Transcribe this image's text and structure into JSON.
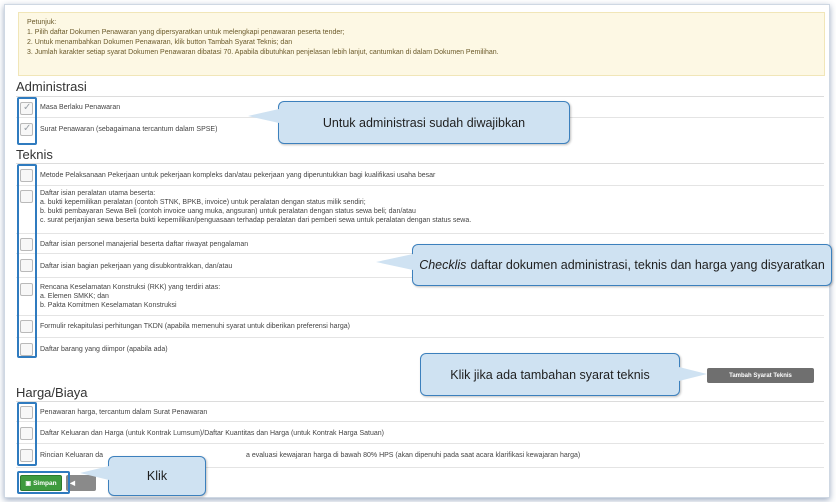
{
  "petunjuk": {
    "title": "Petunjuk:",
    "lines": [
      "1. Pilih daftar Dokumen Penawaran yang dipersyaratkan untuk melengkapi penawaran peserta tender;",
      "2. Untuk menambahkan Dokumen Penawaran, klik button Tambah Syarat Teknis; dan",
      "3. Jumlah karakter setiap syarat Dokumen Penawaran dibatasi 70. Apabila dibutuhkan penjelasan lebih lanjut, cantumkan di dalam Dokumen Pemilihan."
    ]
  },
  "administrasi": {
    "title": "Administrasi",
    "items": [
      {
        "label": "Masa Berlaku Penawaran",
        "checked": true
      },
      {
        "label": "Surat Penawaran (sebagaimana tercantum dalam SPSE)",
        "checked": true
      }
    ]
  },
  "teknis": {
    "title": "Teknis",
    "items": [
      {
        "lines": [
          "Metode Pelaksanaan Pekerjaan untuk pekerjaan kompleks dan/atau pekerjaan yang diperuntukkan bagi kualifikasi usaha besar"
        ],
        "checked": false
      },
      {
        "lines": [
          "Daftar isian peralatan utama beserta:",
          "a. bukti kepemilikan peralatan (contoh STNK, BPKB, invoice) untuk peralatan dengan status milik sendiri;",
          "b. bukti pembayaran Sewa Beli (contoh invoice uang muka, angsuran) untuk peralatan dengan status sewa beli; dan/atau",
          "c. surat perjanjian sewa beserta bukti kepemilikan/penguasaan terhadap peralatan dari pemberi sewa untuk peralatan dengan status sewa."
        ],
        "checked": false
      },
      {
        "lines": [
          "Daftar isian personel manajerial beserta daftar riwayat pengalaman"
        ],
        "checked": false
      },
      {
        "lines": [
          "Daftar isian bagian pekerjaan yang disubkontrakkan, dan/atau"
        ],
        "checked": false
      },
      {
        "lines": [
          "Rencana Keselamatan Konstruksi (RKK) yang terdiri atas:",
          "a. Elemen SMKK; dan",
          "b. Pakta Komitmen Keselamatan Konstruksi"
        ],
        "checked": false
      },
      {
        "lines": [
          "Formulir rekapitulasi perhitungan TKDN (apabila memenuhi syarat untuk diberikan preferensi harga)"
        ],
        "checked": false
      },
      {
        "lines": [
          "Daftar barang yang diimpor (apabila ada)"
        ],
        "checked": false
      }
    ],
    "add_button": "Tambah Syarat Teknis"
  },
  "harga": {
    "title": "Harga/Biaya",
    "items": [
      {
        "label": "Penawaran harga, tercantum dalam Surat Penawaran",
        "checked": false
      },
      {
        "label": "Daftar Keluaran dan Harga (untuk Kontrak Lumsum)/Daftar Kuantitas dan Harga (untuk Kontrak Harga Satuan)",
        "checked": false
      },
      {
        "label_left": "Rincian Keluaran da",
        "label_right": "a evaluasi kewajaran harga di bawah 80% HPS (akan dipenuhi pada saat acara klarifikasi kewajaran harga)",
        "checked": false
      }
    ]
  },
  "buttons": {
    "save": "Simpan",
    "back_icon": "◀"
  },
  "callouts": {
    "admin": "Untuk administrasi sudah diwajibkan",
    "checklist_italic": "Checklis",
    "checklist_rest": "daftar dokumen administrasi, teknis dan harga yang disyaratkan",
    "tambah": "Klik jika ada tambahan syarat teknis",
    "klik": "Klik"
  },
  "icons": {
    "save": "floppy-icon",
    "check": "check-icon"
  },
  "colors": {
    "highlight": "#2f7bbf",
    "callout_bg": "#cfe2f2",
    "save_button": "#3e9b3e"
  }
}
